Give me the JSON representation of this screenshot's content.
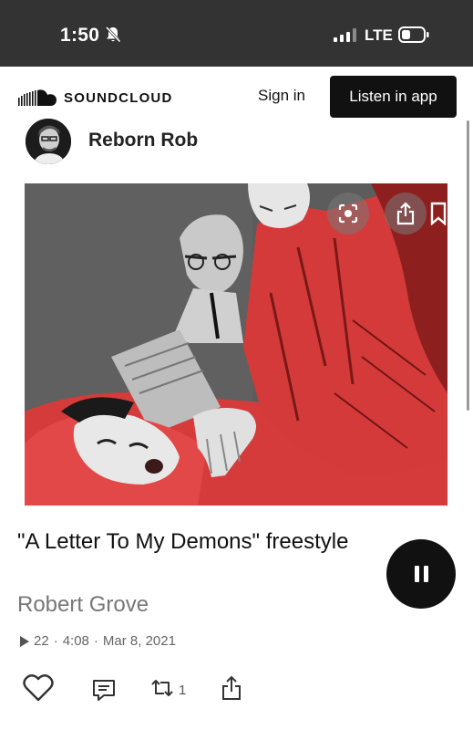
{
  "status_bar": {
    "time": "1:50",
    "network": "LTE",
    "icons": [
      "bell-slash-icon",
      "signal-icon",
      "battery-icon"
    ]
  },
  "header": {
    "brand": "SOUNDCLOUD",
    "sign_in": "Sign in",
    "listen_in_app": "Listen in app"
  },
  "artist": {
    "name": "Reborn Rob"
  },
  "artwork": {
    "overlay_icons": [
      "lens-icon",
      "share-icon",
      "bookmark-icon"
    ]
  },
  "track": {
    "title": "\"A Letter To My Demons\" freestyle",
    "author": "Robert Grove",
    "plays": "22",
    "duration": "4:08",
    "date": "Mar 8, 2021"
  },
  "actions": {
    "repost_count": "1",
    "icons": [
      "heart-icon",
      "comment-icon",
      "repost-icon",
      "share-icon"
    ]
  },
  "colors": {
    "status_bar_bg": "#333333",
    "primary_button": "#111111",
    "artwork_red": "#d43a3a",
    "author_gray": "#777777"
  }
}
